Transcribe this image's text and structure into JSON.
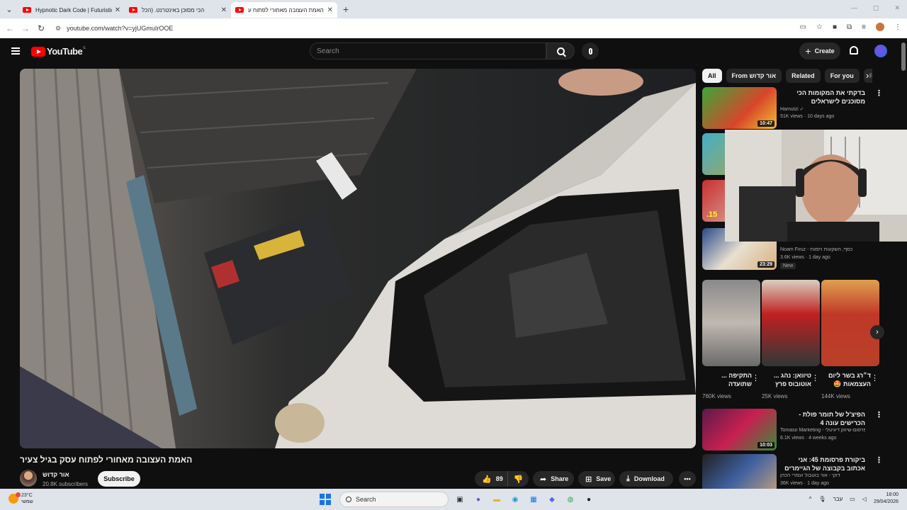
{
  "browser": {
    "tabs": [
      {
        "title": "Hypnotic Dark Code | Futuristic",
        "active": false
      },
      {
        "title": "הכי מסוכן באינטרנט. (הכל",
        "active": false
      },
      {
        "title": "האמת העצובה מאחורי לפתוח ע",
        "active": true
      }
    ],
    "url": "youtube.com/watch?v=yjUGmuIrOOE"
  },
  "youtube": {
    "search_placeholder": "Search",
    "create_label": "Create",
    "country_code": "IL"
  },
  "video": {
    "title": "האמת העצובה מאחורי לפתוח עסק בגיל צעיר",
    "channel": "אור קדוש",
    "subscribers": "20.8K subscribers",
    "subscribe_label": "Subscribe",
    "likes": "89",
    "share_label": "Share",
    "save_label": "Save",
    "download_label": "Download"
  },
  "chips": [
    "All",
    "From אור קדוש",
    "Related",
    "For you",
    "Re"
  ],
  "recommendations": [
    {
      "title": "בדקתי את המקומות הכי מסוכנים לישראלים",
      "channel": "Hamutzi ✓",
      "meta": "51K views · 10 days ago",
      "duration": "10:47"
    },
    {
      "title": "",
      "channel": "",
      "meta": "",
      "duration": ""
    },
    {
      "title": "",
      "channel": "",
      "meta": "",
      "duration": ".15"
    },
    {
      "title": "",
      "channel": "Noam Firuz - כסף, השקעות ויזמות",
      "meta": "3.6K views · 1 day ago",
      "duration": "23:29",
      "badge": "New"
    },
    {
      "title": "הפיצ'ל של תומר פולת - הכרישים עונה 4",
      "channel": "Tomaso Marketing - רד פרסום-שיווק דיגיטלי",
      "meta": "6.1K views · 4 weeks ago",
      "duration": "10:03"
    },
    {
      "title": "ביקורת פרסומת 45: אני אכתוב בקבוצה של הגיימרים",
      "channel": "דוקי - אור בוטבול ועמרי הכהן",
      "meta": "36K views · 1 day ago",
      "duration": ""
    }
  ],
  "shorts": [
    {
      "title": "התקיפה ... שתועדה",
      "views": "760K views"
    },
    {
      "title": "טיוואן: נהג ... אוטובוס פרץ",
      "views": "25K views"
    },
    {
      "title": "ד״רג בשר ליום העצמאות 🤩",
      "views": "144K views"
    }
  ],
  "taskbar": {
    "temperature": "23°C",
    "weather_text": "שמשי",
    "search_label": "Search",
    "time": "18:00",
    "date": "29/04/2026",
    "lang": "עבר"
  }
}
